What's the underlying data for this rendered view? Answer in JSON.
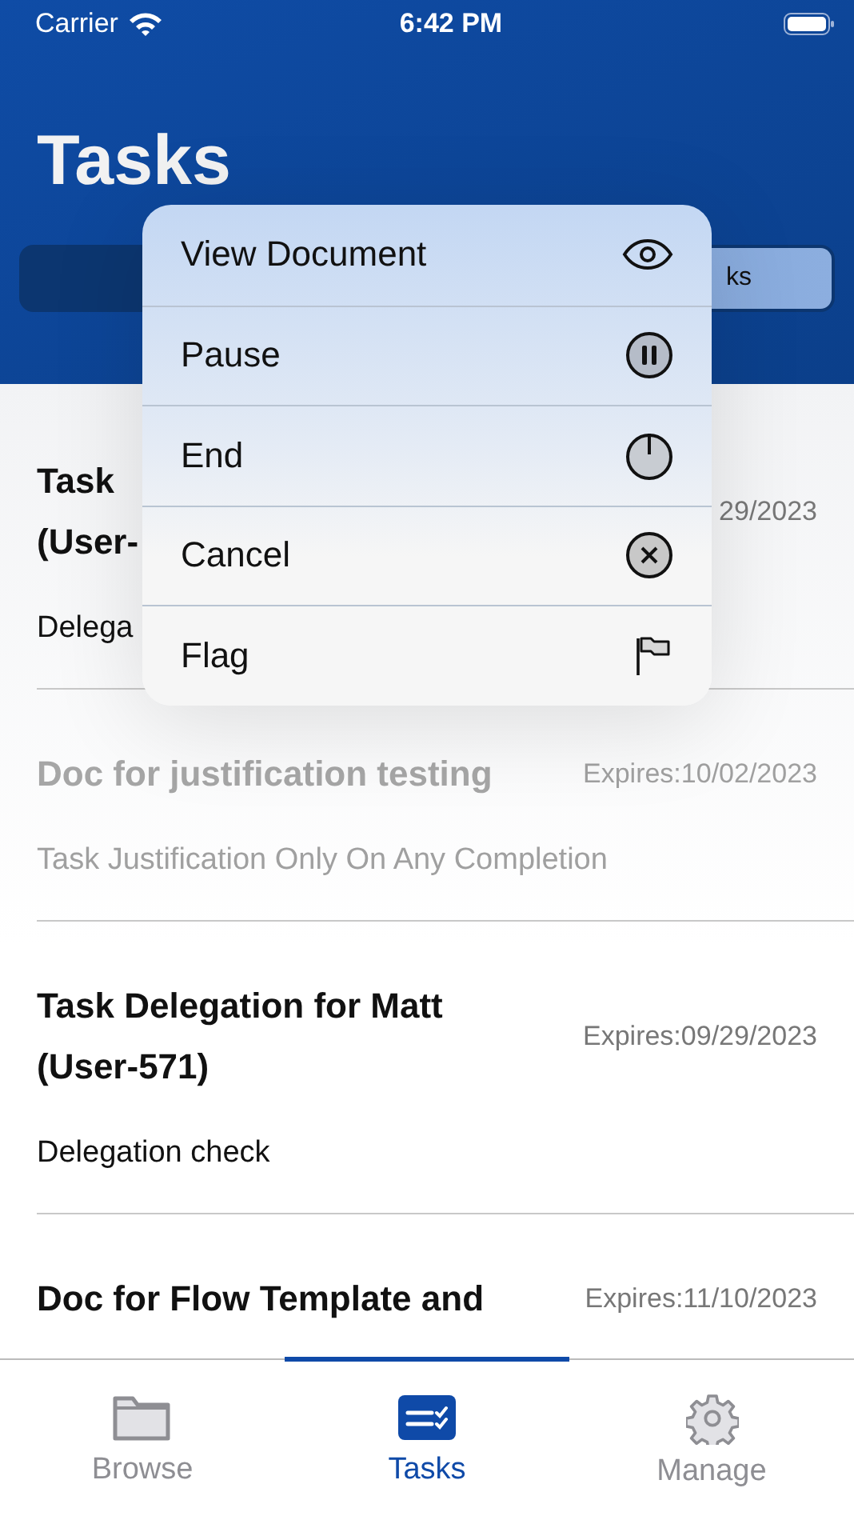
{
  "status_bar": {
    "carrier": "Carrier",
    "time": "6:42 PM"
  },
  "header": {
    "title": "Tasks",
    "segments": [
      {
        "label": "ks",
        "selected": true
      }
    ]
  },
  "tasks": [
    {
      "title_lines": [
        "Task",
        "(User-"
      ],
      "expires": "29/2023",
      "description": "Delega",
      "dimmed": false
    },
    {
      "title_lines": [
        "Doc for justification testing"
      ],
      "expires": "Expires:10/02/2023",
      "description": "Task Justification Only On Any Completion",
      "dimmed": true
    },
    {
      "title_lines": [
        "Task Delegation for Matt",
        "(User-571)"
      ],
      "expires": "Expires:09/29/2023",
      "description": "Delegation check",
      "dimmed": false
    },
    {
      "title_lines": [
        "Doc for Flow Template and"
      ],
      "expires": "Expires:11/10/2023",
      "dimmed": false
    }
  ],
  "context_menu": [
    {
      "label": "View Document",
      "kind": "view"
    },
    {
      "label": "Pause",
      "kind": "pause"
    },
    {
      "label": "End",
      "kind": "end"
    },
    {
      "label": "Cancel",
      "kind": "cancel"
    },
    {
      "label": "Flag",
      "kind": "flag"
    }
  ],
  "tab_bar": [
    {
      "label": "Browse",
      "kind": "browse",
      "selected": false
    },
    {
      "label": "Tasks",
      "kind": "tasks",
      "selected": true
    },
    {
      "label": "Manage",
      "kind": "manage",
      "selected": false
    }
  ]
}
